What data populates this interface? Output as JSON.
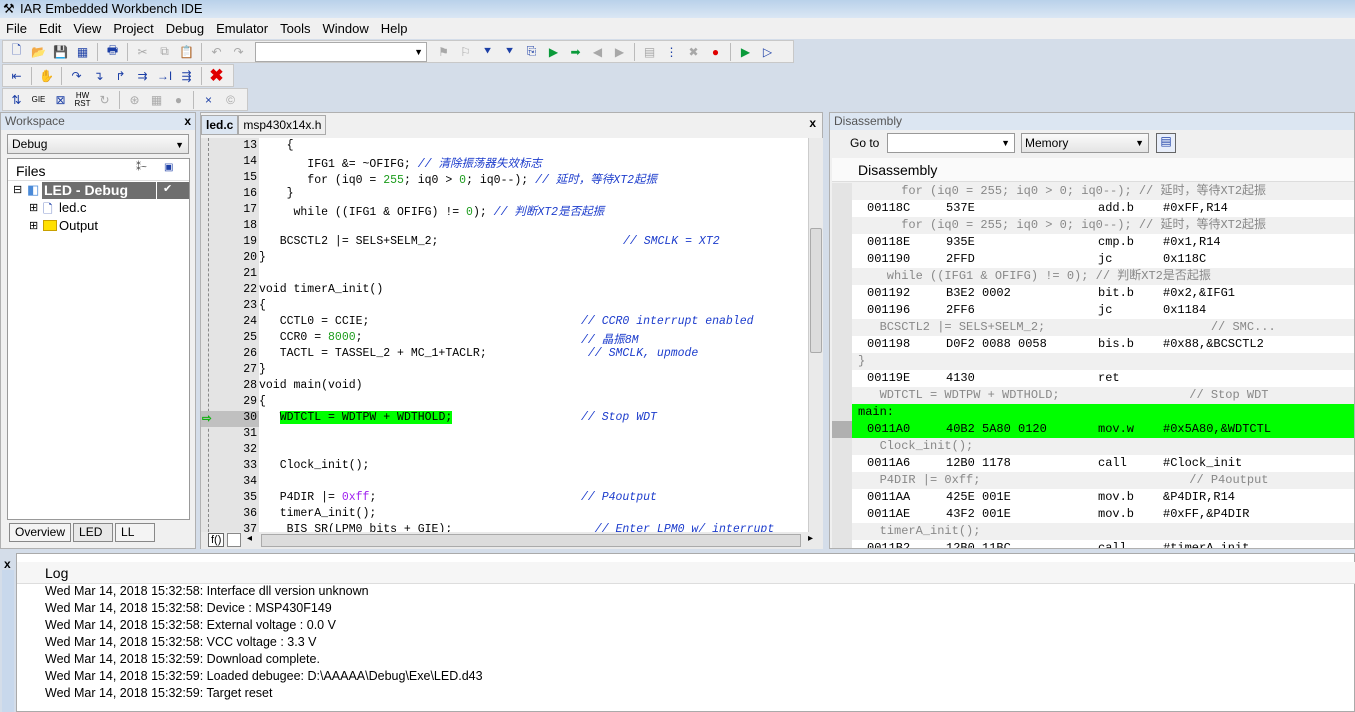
{
  "window": {
    "title": "IAR Embedded Workbench IDE",
    "icon": "iar-tools-icon"
  },
  "menu": [
    "File",
    "Edit",
    "View",
    "Project",
    "Debug",
    "Emulator",
    "Tools",
    "Window",
    "Help"
  ],
  "toolbar1": {
    "icons": [
      "new-file-icon",
      "open-icon",
      "save-icon",
      "save-all-icon",
      "|",
      "print-icon",
      "|",
      "cut-icon",
      "copy-icon",
      "paste-icon",
      "|",
      "undo-icon",
      "redo-icon"
    ],
    "combo_value": "",
    "icons2": [
      "toggle-bookmark-icon",
      "goto-bookmark-icon",
      "toggle-breakpoint-icon",
      "enable-breakpoint-icon",
      "find-in-files-icon",
      "navigate-back-icon",
      "navigate-forward-icon",
      "go-back-icon",
      "go-forward-icon",
      "|",
      "compile-icon",
      "make-icon",
      "stop-build-icon",
      "breakpoint-icon",
      "|",
      "download-debug-icon",
      "debug-without-download-icon"
    ]
  },
  "toolbar2": {
    "icons": [
      "reset-icon",
      "|",
      "break-icon",
      "|",
      "step-over-icon",
      "step-into-icon",
      "step-out-icon",
      "next-statement-icon",
      "run-to-cursor-icon",
      "go-icon",
      "|",
      "stop-debug-icon"
    ]
  },
  "toolbar3": {
    "icons": [
      "emulator-step-icon",
      "gie-icon",
      "release-jtag-icon",
      "hw-reset-icon",
      "cycle-icon",
      "|",
      "trace-icon",
      "memory-icon",
      "power-icon",
      "|",
      "clear-icon",
      "cc-icon"
    ],
    "labels": {
      "gie": "GIE",
      "hw": "HW RST"
    }
  },
  "workspace": {
    "title": "Workspace",
    "close": "x",
    "config": "Debug",
    "columns": {
      "files": "Files"
    },
    "tree": [
      {
        "label": "LED - Debug",
        "check": "✔"
      },
      {
        "label": "led.c"
      },
      {
        "label": "Output"
      }
    ],
    "tabs": [
      "Overview",
      "LED",
      "LL"
    ]
  },
  "editor": {
    "tabs": [
      "led.c",
      "msp430x14x.h"
    ],
    "close": "x",
    "lines": [
      {
        "n": "13",
        "s": [
          [
            "    {",
            ""
          ]
        ]
      },
      {
        "n": "14",
        "s": [
          [
            "       IFG1 &= ~OFIFG; ",
            ""
          ],
          [
            "// 清除振荡器失效标志",
            "cm"
          ]
        ]
      },
      {
        "n": "15",
        "s": [
          [
            "       for (iq0 = ",
            ""
          ],
          [
            "255",
            "num"
          ],
          [
            "; iq0 > ",
            ""
          ],
          [
            "0",
            "num"
          ],
          [
            "; iq0--); ",
            ""
          ],
          [
            "// 延时，等待XT2起振",
            "cm"
          ]
        ]
      },
      {
        "n": "16",
        "s": [
          [
            "    }",
            ""
          ]
        ]
      },
      {
        "n": "17",
        "s": [
          [
            "     while ((IFG1 & OFIFG) != ",
            ""
          ],
          [
            "0",
            "num"
          ],
          [
            "); ",
            ""
          ],
          [
            "// 判断XT2是否起振",
            "cm"
          ]
        ]
      },
      {
        "n": "18",
        "s": []
      },
      {
        "n": "19",
        "s": [
          [
            "   BCSCTL2 |= SELS+SELM_2;",
            ""
          ]
        ],
        "c": "// SMCLK = XT2"
      },
      {
        "n": "20",
        "s": [
          [
            "}",
            ""
          ]
        ]
      },
      {
        "n": "21",
        "s": []
      },
      {
        "n": "22",
        "s": [
          [
            "void timerA_init()",
            ""
          ]
        ]
      },
      {
        "n": "23",
        "s": [
          [
            "{",
            ""
          ]
        ]
      },
      {
        "n": "24",
        "s": [
          [
            "   CCTL0 = CCIE;",
            ""
          ]
        ],
        "c": "// CCR0 interrupt enabled"
      },
      {
        "n": "25",
        "s": [
          [
            "   CCR0 = ",
            ""
          ],
          [
            "8000",
            "num"
          ],
          [
            ";",
            ""
          ]
        ],
        "c": "// 晶振8M"
      },
      {
        "n": "26",
        "s": [
          [
            "   TACTL = TASSEL_2 + MC_1+TACLR;",
            ""
          ]
        ],
        "c": " // SMCLK, upmode"
      },
      {
        "n": "27",
        "s": [
          [
            "}",
            ""
          ]
        ]
      },
      {
        "n": "28",
        "s": [
          [
            "void main(void)",
            ""
          ]
        ]
      },
      {
        "n": "29",
        "s": [
          [
            "{",
            ""
          ]
        ]
      },
      {
        "n": "30",
        "s": [
          [
            "   ",
            ""
          ],
          [
            "WDTCTL = WDTPW + WDTHOLD;",
            "hl"
          ]
        ],
        "c": "// Stop WDT",
        "current": true
      },
      {
        "n": "31",
        "s": []
      },
      {
        "n": "32",
        "s": []
      },
      {
        "n": "33",
        "s": [
          [
            "   Clock_init();",
            ""
          ]
        ]
      },
      {
        "n": "34",
        "s": []
      },
      {
        "n": "35",
        "s": [
          [
            "   P4DIR |= ",
            ""
          ],
          [
            "0xff",
            "hex"
          ],
          [
            ";",
            ""
          ]
        ],
        "c": "// P4output"
      },
      {
        "n": "36",
        "s": [
          [
            "   timerA_init();",
            ""
          ]
        ]
      },
      {
        "n": "37",
        "s": [
          [
            "   _BIS_SR(LPM0_bits + GIE);",
            ""
          ]
        ],
        "c": "  // Enter LPM0 w/ interrupt"
      }
    ],
    "bottom": {
      "func": "f()"
    }
  },
  "disassembly": {
    "title": "Disassembly",
    "goto_label": "Go to",
    "goto_value": "",
    "memory_select": "Memory",
    "header": "Disassembly",
    "rows": [
      {
        "src": "      for (iq0 = 255; iq0 > 0; iq0--); // 延时，等待XT2起振"
      },
      {
        "a": "00118C",
        "c": "537E",
        "m": "add.b",
        "o": "#0xFF,R14"
      },
      {
        "src": "      for (iq0 = 255; iq0 > 0; iq0--); // 延时，等待XT2起振"
      },
      {
        "a": "00118E",
        "c": "935E",
        "m": "cmp.b",
        "o": "#0x1,R14"
      },
      {
        "a": "001190",
        "c": "2FFD",
        "m": "jc",
        "o": "0x118C"
      },
      {
        "src": "    while ((IFG1 & OFIFG) != 0); // 判断XT2是否起振"
      },
      {
        "a": "001192",
        "c": "B3E2 0002",
        "m": "bit.b",
        "o": "#0x2,&IFG1"
      },
      {
        "a": "001196",
        "c": "2FF6",
        "m": "jc",
        "o": "0x1184"
      },
      {
        "src": "   BCSCTL2 |= SELS+SELM_2;                       // SMC..."
      },
      {
        "a": "001198",
        "c": "D0F2 0088 0058",
        "m": "bis.b",
        "o": "#0x88,&BCSCTL2"
      },
      {
        "src": "}"
      },
      {
        "a": "00119E",
        "c": "4130",
        "m": "ret",
        "o": ""
      },
      {
        "src": "   WDTCTL = WDTPW + WDTHOLD;                  // Stop WDT"
      },
      {
        "label": "main:",
        "current": true
      },
      {
        "a": "0011A0",
        "c": "40B2 5A80 0120",
        "m": "mov.w",
        "o": "#0x5A80,&WDTCTL",
        "current": true
      },
      {
        "src": "   Clock_init();"
      },
      {
        "a": "0011A6",
        "c": "12B0 1178",
        "m": "call",
        "o": "#Clock_init"
      },
      {
        "src": "   P4DIR |= 0xff;                             // P4output"
      },
      {
        "a": "0011AA",
        "c": "425E 001E",
        "m": "mov.b",
        "o": "&P4DIR,R14"
      },
      {
        "a": "0011AE",
        "c": "43F2 001E",
        "m": "mov.b",
        "o": "#0xFF,&P4DIR"
      },
      {
        "src": "   timerA_init();"
      },
      {
        "a": "0011B2",
        "c": "12B0 11BC",
        "m": "call",
        "o": "#timerA_init"
      }
    ]
  },
  "log": {
    "close": "x",
    "header": "Log",
    "entries": [
      "Wed Mar 14, 2018 15:32:58: Interface dll version unknown",
      "Wed Mar 14, 2018 15:32:58: Device : MSP430F149",
      "Wed Mar 14, 2018 15:32:58: External voltage : 0.0 V",
      "Wed Mar 14, 2018 15:32:58: VCC voltage : 3.3 V",
      "Wed Mar 14, 2018 15:32:59: Download complete.",
      "Wed Mar 14, 2018 15:32:59: Loaded debugee: D:\\AAAAA\\Debug\\Exe\\LED.d43",
      "Wed Mar 14, 2018 15:32:59: Target reset"
    ]
  },
  "colors": {
    "current_statement": "#00ff00",
    "comment": "#1c3ccc",
    "number": "#1c9c1c",
    "hex": "#a020f0"
  }
}
